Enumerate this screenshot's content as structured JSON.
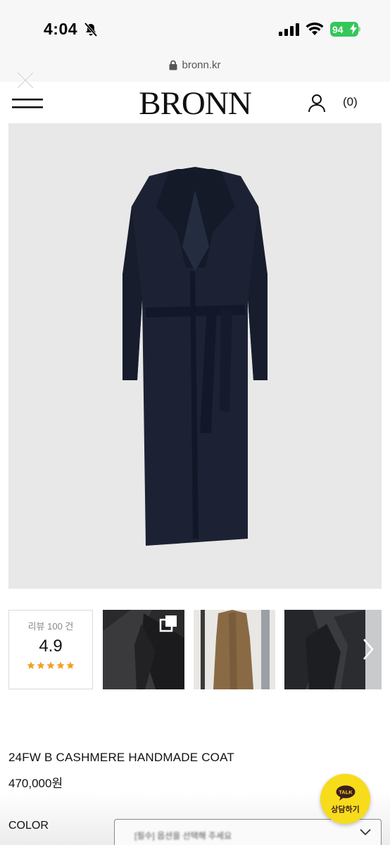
{
  "status_bar": {
    "time": "4:04",
    "battery": "94"
  },
  "browser": {
    "url": "bronn.kr"
  },
  "header": {
    "logo": "BRONN",
    "cart_count": "(0)"
  },
  "reviews": {
    "count_label": "리뷰 100 건",
    "score": "4.9",
    "stars": 5
  },
  "product": {
    "name": "24FW B CASHMERE HANDMADE COAT",
    "price": "470,000원",
    "color_label": "COLOR",
    "color_select_value": "[필수] 옵션을 선택해 주세요"
  },
  "chat": {
    "badge": "TALK",
    "label": "상담하기"
  },
  "colors": {
    "coat": "#1c2233",
    "image_bg": "#e8e8e8",
    "star": "#f0a020",
    "battery": "#34c759",
    "kakao": "#f7dc1c"
  }
}
